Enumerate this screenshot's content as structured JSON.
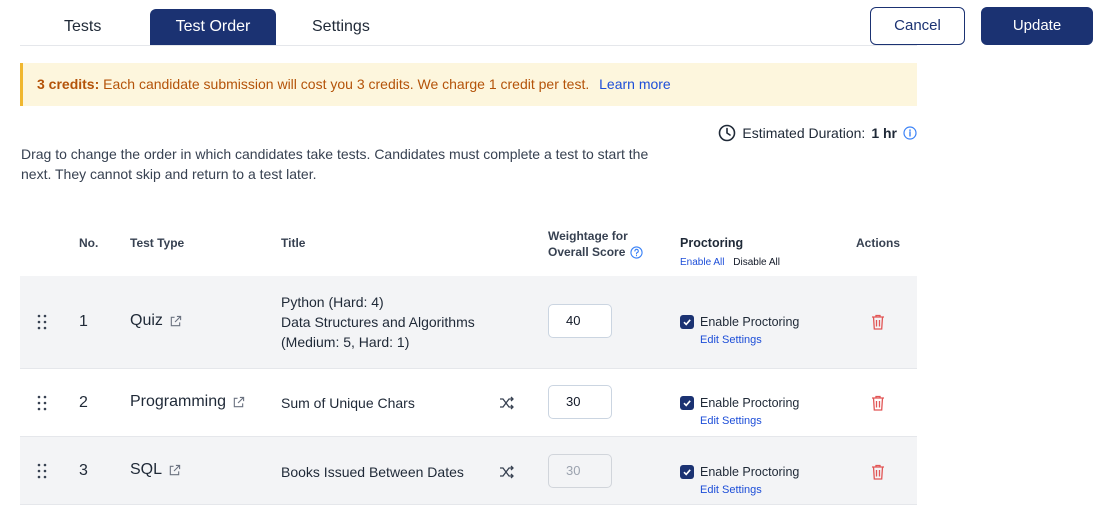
{
  "tabs": [
    {
      "label": "Tests"
    },
    {
      "label": "Test Order"
    },
    {
      "label": "Settings"
    }
  ],
  "actions": {
    "cancel": "Cancel",
    "update": "Update"
  },
  "banner": {
    "strong": "3 credits:",
    "text": "Each candidate submission will cost you 3 credits. We charge 1 credit per test.",
    "link": "Learn more"
  },
  "duration": {
    "label": "Estimated Duration:",
    "value": "1 hr"
  },
  "description": "Drag to change the order in which candidates take tests. Candidates must complete a test to start the next. They cannot skip and return to a test later.",
  "table": {
    "headers": {
      "no": "No.",
      "type": "Test Type",
      "title": "Title",
      "weight_line1": "Weightage for",
      "weight_line2": "Overall Score",
      "proctoring": "Proctoring",
      "enable_all": "Enable All",
      "disable_all": "Disable All",
      "actions": "Actions"
    },
    "rows": [
      {
        "no": "1",
        "type": "Quiz",
        "title_lines": [
          "Python (Hard: 4)",
          "Data Structures and Algorithms",
          "(Medium: 5, Hard: 1)"
        ],
        "weight": "40",
        "proctoring_label": "Enable Proctoring",
        "edit_label": "Edit Settings"
      },
      {
        "no": "2",
        "type": "Programming",
        "title": "Sum of Unique Chars",
        "weight": "30",
        "proctoring_label": "Enable Proctoring",
        "edit_label": "Edit Settings"
      },
      {
        "no": "3",
        "type": "SQL",
        "title": "Books Issued Between Dates",
        "weight": "30",
        "proctoring_label": "Enable Proctoring",
        "edit_label": "Edit Settings"
      }
    ]
  },
  "colors": {
    "primary": "#1b3272",
    "link": "#1d4ed8",
    "banner_bg": "#fdf6dd",
    "banner_accent": "#f0b72f",
    "danger": "#e25555"
  }
}
